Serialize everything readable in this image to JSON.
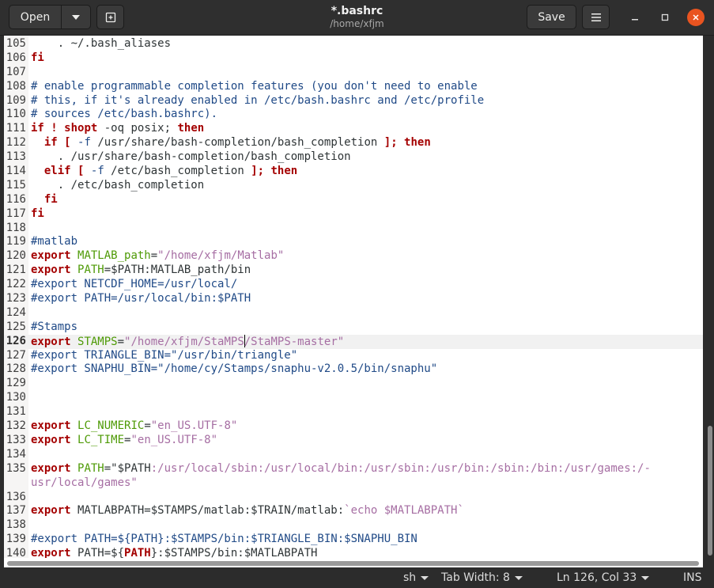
{
  "header": {
    "open_label": "Open",
    "title": "*.bashrc",
    "subtitle": "/home/xfjm",
    "save_label": "Save",
    "icons": [
      "chevron-down-icon",
      "new-tab-icon",
      "hamburger-menu-icon",
      "minimize-icon",
      "maximize-icon",
      "close-icon"
    ],
    "close_color": "#e95420"
  },
  "editor": {
    "cursor": {
      "line": 126,
      "col": 33
    },
    "lines": [
      {
        "n": "105",
        "segments": [
          [
            "t",
            "    . ~/.bash_aliases"
          ]
        ]
      },
      {
        "n": "106",
        "segments": [
          [
            "kw",
            "fi"
          ]
        ]
      },
      {
        "n": "107",
        "segments": []
      },
      {
        "n": "108",
        "segments": [
          [
            "cm",
            "# enable programmable completion features (you don't need to enable"
          ]
        ]
      },
      {
        "n": "109",
        "segments": [
          [
            "cm",
            "# this, if it's already enabled in /etc/bash.bashrc and /etc/profile"
          ]
        ]
      },
      {
        "n": "110",
        "segments": [
          [
            "cm",
            "# sources /etc/bash.bashrc)."
          ]
        ]
      },
      {
        "n": "111",
        "segments": [
          [
            "kw",
            "if"
          ],
          [
            "t",
            " "
          ],
          [
            "kw",
            "!"
          ],
          [
            "t",
            " "
          ],
          [
            "kw",
            "shopt"
          ],
          [
            "t",
            " -oq posix; "
          ],
          [
            "kw",
            "then"
          ]
        ]
      },
      {
        "n": "112",
        "segments": [
          [
            "t",
            "  "
          ],
          [
            "kw",
            "if"
          ],
          [
            "t",
            " "
          ],
          [
            "kw",
            "["
          ],
          [
            "t",
            " "
          ],
          [
            "cm",
            "-f"
          ],
          [
            "t",
            " /usr/share/bash-completion/bash_completion "
          ],
          [
            "kw",
            "]; then"
          ]
        ]
      },
      {
        "n": "113",
        "segments": [
          [
            "t",
            "    . /usr/share/bash-completion/bash_completion"
          ]
        ]
      },
      {
        "n": "114",
        "segments": [
          [
            "t",
            "  "
          ],
          [
            "kw",
            "elif"
          ],
          [
            "t",
            " "
          ],
          [
            "kw",
            "["
          ],
          [
            "t",
            " "
          ],
          [
            "cm",
            "-f"
          ],
          [
            "t",
            " /etc/bash_completion "
          ],
          [
            "kw",
            "]; then"
          ]
        ]
      },
      {
        "n": "115",
        "segments": [
          [
            "t",
            "    . /etc/bash_completion"
          ]
        ]
      },
      {
        "n": "116",
        "segments": [
          [
            "t",
            "  "
          ],
          [
            "kw",
            "fi"
          ]
        ]
      },
      {
        "n": "117",
        "segments": [
          [
            "kw",
            "fi"
          ]
        ]
      },
      {
        "n": "118",
        "segments": []
      },
      {
        "n": "119",
        "segments": [
          [
            "cm",
            "#matlab"
          ]
        ]
      },
      {
        "n": "120",
        "segments": [
          [
            "kw",
            "export"
          ],
          [
            "t",
            " "
          ],
          [
            "var",
            "MATLAB_path"
          ],
          [
            "t",
            "="
          ],
          [
            "str",
            "\"/home/xfjm/Matlab\""
          ]
        ]
      },
      {
        "n": "121",
        "segments": [
          [
            "kw",
            "export"
          ],
          [
            "t",
            " "
          ],
          [
            "var",
            "PATH"
          ],
          [
            "t",
            "=$PATH:MATLAB_path/bin"
          ]
        ]
      },
      {
        "n": "122",
        "segments": [
          [
            "cm",
            "#export NETCDF_HOME=/usr/local/"
          ]
        ]
      },
      {
        "n": "123",
        "segments": [
          [
            "cm",
            "#export PATH=/usr/local/bin:$PATH"
          ]
        ]
      },
      {
        "n": "124",
        "segments": []
      },
      {
        "n": "125",
        "segments": [
          [
            "cm",
            "#Stamps"
          ]
        ]
      },
      {
        "n": "126",
        "segments": [
          [
            "kw",
            "export"
          ],
          [
            "t",
            " "
          ],
          [
            "var",
            "STAMPS"
          ],
          [
            "t",
            "="
          ],
          [
            "str",
            "\"/home/xfjm/StaMPS"
          ],
          [
            "cursor",
            ""
          ],
          [
            "str",
            "/StaMPS-master\""
          ]
        ],
        "current": true
      },
      {
        "n": "127",
        "segments": [
          [
            "cm",
            "#export TRIANGLE_BIN=\"/usr/bin/triangle\""
          ]
        ]
      },
      {
        "n": "128",
        "segments": [
          [
            "cm",
            "#export SNAPHU_BIN=\"/home/cy/Stamps/snaphu-v2.0.5/bin/snaphu\""
          ]
        ]
      },
      {
        "n": "129",
        "segments": []
      },
      {
        "n": "130",
        "segments": []
      },
      {
        "n": "131",
        "segments": []
      },
      {
        "n": "132",
        "segments": [
          [
            "kw",
            "export"
          ],
          [
            "t",
            " "
          ],
          [
            "var",
            "LC_NUMERIC"
          ],
          [
            "t",
            "="
          ],
          [
            "str",
            "\"en_US.UTF-8\""
          ]
        ]
      },
      {
        "n": "133",
        "segments": [
          [
            "kw",
            "export"
          ],
          [
            "t",
            " "
          ],
          [
            "var",
            "LC_TIME"
          ],
          [
            "t",
            "="
          ],
          [
            "str",
            "\"en_US.UTF-8\""
          ]
        ]
      },
      {
        "n": "134",
        "segments": []
      },
      {
        "n": "135",
        "segments": [
          [
            "kw",
            "export"
          ],
          [
            "t",
            " "
          ],
          [
            "var",
            "PATH"
          ],
          [
            "t",
            "=\"$PATH"
          ],
          [
            "str",
            ":/usr/local/sbin:/usr/local/bin:/usr/sbin:/usr/bin:/sbin:/bin:/usr/games:/-"
          ]
        ]
      },
      {
        "n": "",
        "segments": [
          [
            "str",
            "usr/local/games\""
          ]
        ]
      },
      {
        "n": "136",
        "segments": []
      },
      {
        "n": "137",
        "segments": [
          [
            "kw",
            "export"
          ],
          [
            "t",
            " MATLABPATH=$STAMPS/matlab:$TRAIN/matlab:"
          ],
          [
            "str",
            "`echo $MATLABPATH`"
          ]
        ]
      },
      {
        "n": "138",
        "segments": []
      },
      {
        "n": "139",
        "segments": [
          [
            "cm",
            "#export PATH=${PATH}:$STAMPS/bin:$TRIANGLE_BIN:$SNAPHU_BIN"
          ]
        ]
      },
      {
        "n": "140",
        "segments": [
          [
            "kw",
            "export"
          ],
          [
            "t",
            " PATH=${"
          ],
          [
            "kw",
            "PATH"
          ],
          [
            "t",
            "}:$STAMPS/bin:$MATLABPATH"
          ]
        ]
      }
    ]
  },
  "statusbar": {
    "language": "sh",
    "tab_width": "Tab Width: 8",
    "position": "Ln 126, Col 33",
    "mode": "INS"
  }
}
